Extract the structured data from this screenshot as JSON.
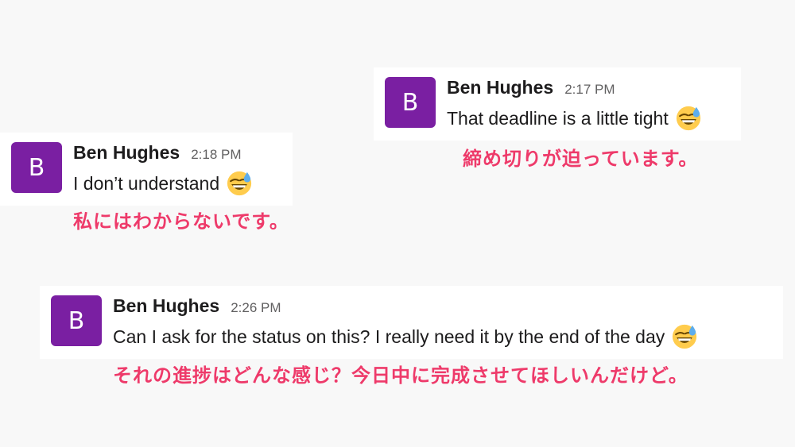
{
  "colors": {
    "page_background": "#f8f8f8",
    "card_background": "#ffffff",
    "avatar": "#7a1fa2",
    "translation_text": "#ee3a6a"
  },
  "messages": [
    {
      "avatar_letter": "B",
      "author": "Ben Hughes",
      "time": "2:17 PM",
      "text": "That deadline is a little tight",
      "emoji": "grinning-face-with-sweat-icon",
      "translation": "締め切りが迫っています。"
    },
    {
      "avatar_letter": "B",
      "author": "Ben Hughes",
      "time": "2:18 PM",
      "text": "I don’t understand",
      "emoji": "grinning-face-with-sweat-icon",
      "translation": "私にはわからないです。"
    },
    {
      "avatar_letter": "B",
      "author": "Ben Hughes",
      "time": "2:26 PM",
      "text": "Can I ask for the status on this? I really need it by the end of the day",
      "emoji": "grinning-face-with-sweat-icon",
      "translation": "それの進捗はどんな感じ？今日中に完成させてほしいんだけど。"
    }
  ]
}
